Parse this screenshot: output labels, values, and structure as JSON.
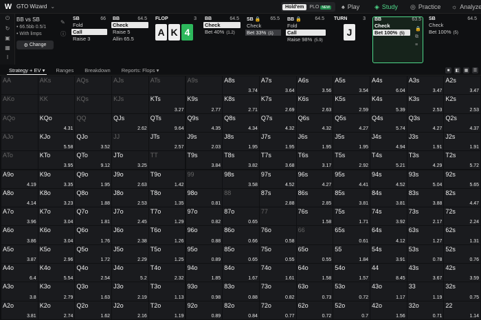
{
  "app": {
    "brand": "GTO Wizard"
  },
  "modes": [
    {
      "label": "Hold'em",
      "active": true
    },
    {
      "label": "PLO",
      "active": false,
      "badge": "NEW"
    }
  ],
  "nav": [
    {
      "label": "Play",
      "icon": "spade-icon",
      "glyph": "♠",
      "active": false
    },
    {
      "label": "Study",
      "icon": "study-icon",
      "glyph": "◈",
      "active": true
    },
    {
      "label": "Practice",
      "icon": "gamepad-icon",
      "glyph": "◎",
      "active": false
    },
    {
      "label": "Analyze",
      "icon": "analyze-icon",
      "glyph": "☼",
      "active": false
    }
  ],
  "spot": {
    "title": "BB vs SB",
    "stack_line": "66.5bb 0.5/1",
    "limp_line": "With limps",
    "change_label": "Change"
  },
  "columns": [
    {
      "pos": "SB",
      "stack": "66",
      "actions": [
        {
          "label": "Fold",
          "style": ""
        },
        {
          "label": "Call",
          "style": "sel"
        },
        {
          "label": "Raise 3",
          "style": ""
        }
      ]
    },
    {
      "pos": "BB",
      "stack": "64.5",
      "actions": [
        {
          "label": "Check",
          "style": "sel"
        },
        {
          "label": "Raise 5",
          "style": ""
        },
        {
          "label": "Allin 65.5",
          "style": ""
        }
      ]
    },
    {
      "pos": "FLOP",
      "stack": "3",
      "cards": [
        {
          "r": "A",
          "g": false
        },
        {
          "r": "K",
          "g": false
        },
        {
          "r": "4",
          "g": true
        }
      ]
    },
    {
      "pos": "BB",
      "stack": "64.5",
      "actions": [
        {
          "label": "Check",
          "style": "sel"
        },
        {
          "label": "Bet 40%",
          "style": "",
          "n": "(1.2)"
        }
      ]
    },
    {
      "pos": "SB",
      "stack": "65.5",
      "lock": true,
      "actions": [
        {
          "label": "Check",
          "style": ""
        },
        {
          "label": "Bet 33%",
          "style": "dk",
          "n": "(1)"
        }
      ]
    },
    {
      "pos": "BB",
      "stack": "64.5",
      "lock": true,
      "actions": [
        {
          "label": "Fold",
          "style": ""
        },
        {
          "label": "Call",
          "style": "sel"
        },
        {
          "label": "Raise 98%",
          "style": "",
          "n": "(5.9)"
        }
      ]
    },
    {
      "pos": "TURN",
      "stack": "3",
      "cards": [
        {
          "r": "J",
          "g": false
        }
      ]
    },
    {
      "pos": "BB",
      "stack": "63.5",
      "current": true,
      "actions": [
        {
          "label": "Check",
          "style": ""
        },
        {
          "label": "Bet 100%",
          "style": "",
          "n": "(5)"
        }
      ]
    },
    {
      "pos": "SB",
      "stack": "64.5",
      "actions": [
        {
          "label": "Check",
          "style": ""
        },
        {
          "label": "Bet 100%",
          "style": "",
          "n": "(5)"
        }
      ]
    }
  ],
  "tabs": [
    {
      "label": "Strategy + EV ▾",
      "active": true
    },
    {
      "label": "Ranges",
      "active": false
    },
    {
      "label": "Breakdown",
      "active": false
    },
    {
      "label": "Reports: Flops ▾",
      "active": false
    }
  ],
  "hands": [
    [
      "AA",
      "",
      "0"
    ],
    [
      "AKs",
      "",
      "0"
    ],
    [
      "AQs",
      "",
      "0"
    ],
    [
      "AJs",
      "",
      "0"
    ],
    [
      "ATs",
      "",
      "0"
    ],
    [
      "A9s",
      "",
      "0"
    ],
    [
      "A8s",
      "3.74",
      "0.06"
    ],
    [
      "A7s",
      "3.64",
      "0.06"
    ],
    [
      "A6s",
      "3.56",
      "0.05"
    ],
    [
      "A5s",
      "3.54",
      "0.05"
    ],
    [
      "A4s",
      "6.04",
      "0.04"
    ],
    [
      "A3s",
      "3.47",
      "0.28"
    ],
    [
      "A2s",
      "3.47",
      "0.5"
    ],
    [
      "AKo",
      "",
      "0"
    ],
    [
      "KK",
      "",
      "0"
    ],
    [
      "KQs",
      "",
      "0"
    ],
    [
      "KJs",
      "",
      "0"
    ],
    [
      "KTs",
      "3.27",
      "0"
    ],
    [
      "K9s",
      "2.77",
      "0.04"
    ],
    [
      "K8s",
      "2.71",
      "0.04"
    ],
    [
      "K7s",
      "2.69",
      "0.1"
    ],
    [
      "K6s",
      "2.63",
      "0.1"
    ],
    [
      "K5s",
      "2.59",
      "0.8"
    ],
    [
      "K4s",
      "5.39",
      "0.7"
    ],
    [
      "K3s",
      "2.53",
      "0.96"
    ],
    [
      "K2s",
      "2.53",
      "0.96"
    ],
    [
      "AQo",
      "",
      "0"
    ],
    [
      "KQo",
      "4.31",
      "0"
    ],
    [
      "QQ",
      "",
      "0"
    ],
    [
      "QJs",
      "2.62",
      "0"
    ],
    [
      "QTs",
      "9.64",
      "0"
    ],
    [
      "Q9s",
      "4.35",
      "0.04"
    ],
    [
      "Q8s",
      "4.34",
      "0.15"
    ],
    [
      "Q7s",
      "4.32",
      "0.9"
    ],
    [
      "Q6s",
      "4.32",
      "0.9"
    ],
    [
      "Q5s",
      "4.27",
      "0.9"
    ],
    [
      "Q4s",
      "5.74",
      "0.9"
    ],
    [
      "Q3s",
      "4.27",
      "0.96"
    ],
    [
      "Q2s",
      "4.37",
      "0.96"
    ],
    [
      "AJo",
      "",
      "0"
    ],
    [
      "KJo",
      "5.58",
      "0"
    ],
    [
      "QJo",
      "3.52",
      "0.15"
    ],
    [
      "JJ",
      "",
      "0"
    ],
    [
      "JTs",
      "2.57",
      "0"
    ],
    [
      "J9s",
      "2.03",
      "0.06"
    ],
    [
      "J8s",
      "1.95",
      "0.96"
    ],
    [
      "J7s",
      "1.95",
      "0.96"
    ],
    [
      "J6s",
      "1.95",
      "0.96"
    ],
    [
      "J5s",
      "1.95",
      "0.96"
    ],
    [
      "J4s",
      "4.94",
      "0.96"
    ],
    [
      "J3s",
      "1.91",
      "0.96"
    ],
    [
      "J2s",
      "1.91",
      "0.96"
    ],
    [
      "ATo",
      "",
      "0"
    ],
    [
      "KTo",
      "3.95",
      "0.25"
    ],
    [
      "QTo",
      "9.12",
      "0.4"
    ],
    [
      "JTo",
      "3.25",
      "0.45"
    ],
    [
      "TT",
      "",
      "0"
    ],
    [
      "T9s",
      "3.84",
      "0.06"
    ],
    [
      "T8s",
      "3.82",
      "0.96"
    ],
    [
      "T7s",
      "3.68",
      "0.96"
    ],
    [
      "T6s",
      "3.17",
      "0.96"
    ],
    [
      "T5s",
      "2.92",
      "0.96"
    ],
    [
      "T4s",
      "5.21",
      "0.96"
    ],
    [
      "T3s",
      "4.29",
      "0.96"
    ],
    [
      "T2s",
      "5.72",
      "0.96"
    ],
    [
      "A9o",
      "4.19",
      "0"
    ],
    [
      "K9o",
      "3.35",
      "0.45"
    ],
    [
      "Q9o",
      "1.95",
      "0.96"
    ],
    [
      "J9o",
      "2.63",
      "0.96"
    ],
    [
      "T9o",
      "1.42",
      "0.96"
    ],
    [
      "99",
      "",
      "0"
    ],
    [
      "98s",
      "3.58",
      "0.06"
    ],
    [
      "97s",
      "4.52",
      "0.96"
    ],
    [
      "96s",
      "4.27",
      "0.96"
    ],
    [
      "95s",
      "4.41",
      "0.96"
    ],
    [
      "94s",
      "4.52",
      "0.96"
    ],
    [
      "93s",
      "5.04",
      "0.96"
    ],
    [
      "92s",
      "5.65",
      "0.96"
    ],
    [
      "A8o",
      "4.14",
      "0"
    ],
    [
      "K8o",
      "3.23",
      "0.45"
    ],
    [
      "Q8o",
      "1.88",
      "0.96"
    ],
    [
      "J8o",
      "2.53",
      "0.96"
    ],
    [
      "T8o",
      "1.35",
      "0.96"
    ],
    [
      "98o",
      "0.81",
      "0.96"
    ],
    [
      "88",
      "",
      "0"
    ],
    [
      "87s",
      "2.88",
      "0.96"
    ],
    [
      "86s",
      "2.85",
      "0.96"
    ],
    [
      "85s",
      "3.81",
      "0.96"
    ],
    [
      "84s",
      "3.81",
      "0.96"
    ],
    [
      "83s",
      "3.88",
      "0.96"
    ],
    [
      "82s",
      "4.47",
      "0.96"
    ],
    [
      "A7o",
      "3.96",
      "0"
    ],
    [
      "K7o",
      "3.04",
      "0.45"
    ],
    [
      "Q7o",
      "1.81",
      "0.96"
    ],
    [
      "J7o",
      "2.45",
      "0.96"
    ],
    [
      "T7o",
      "1.29",
      "0.96"
    ],
    [
      "97o",
      "0.82",
      "0.96"
    ],
    [
      "87o",
      "0.65",
      "0.96"
    ],
    [
      "77",
      "",
      "0"
    ],
    [
      "76s",
      "1.58",
      "0.04"
    ],
    [
      "75s",
      "1.71",
      "0.04"
    ],
    [
      "74s",
      "3.92",
      "0.1"
    ],
    [
      "73s",
      "2.17",
      "0.96"
    ],
    [
      "72s",
      "2.24",
      "0.96"
    ],
    [
      "A6o",
      "3.86",
      "0.96"
    ],
    [
      "K6o",
      "3.04",
      "0.96"
    ],
    [
      "Q6o",
      "1.76",
      "0.96"
    ],
    [
      "J6o",
      "2.38",
      "0.96"
    ],
    [
      "T6o",
      "1.26",
      "0.96"
    ],
    [
      "96o",
      "0.88",
      "0.96"
    ],
    [
      "86o",
      "0.66",
      "0.96"
    ],
    [
      "76o",
      "0.58",
      "0.96"
    ],
    [
      "66",
      "",
      "0"
    ],
    [
      "65s",
      "0.61",
      "0.04"
    ],
    [
      "64s",
      "4.12",
      "0.04"
    ],
    [
      "63s",
      "1.27",
      "0.04"
    ],
    [
      "62s",
      "1.31",
      "0.04"
    ],
    [
      "A5o",
      "3.87",
      "0.96"
    ],
    [
      "K5o",
      "2.96",
      "0.96"
    ],
    [
      "Q5o",
      "1.72",
      "0.96"
    ],
    [
      "J5o",
      "2.29",
      "0.96"
    ],
    [
      "T5o",
      "1.25",
      "0.96"
    ],
    [
      "95o",
      "0.89",
      "0.96"
    ],
    [
      "85o",
      "0.65",
      "0.96"
    ],
    [
      "75o",
      "0.55",
      "0.96"
    ],
    [
      "65o",
      "0.55",
      "0.96"
    ],
    [
      "55",
      "1.84",
      "0"
    ],
    [
      "54s",
      "3.91",
      "0.04"
    ],
    [
      "53s",
      "0.78",
      "0.04"
    ],
    [
      "52s",
      "0.76",
      "0.04"
    ],
    [
      "A4o",
      "6.4",
      "0.96"
    ],
    [
      "K4o",
      "5.54",
      "0.96"
    ],
    [
      "Q4o",
      "2.54",
      "0.96"
    ],
    [
      "J4o",
      "5.2",
      "0.96"
    ],
    [
      "T4o",
      "2.32",
      "0.96"
    ],
    [
      "94o",
      "1.85",
      "0.96"
    ],
    [
      "84o",
      "1.67",
      "0.96"
    ],
    [
      "74o",
      "1.61",
      "0.96"
    ],
    [
      "64o",
      "1.58",
      "0.96"
    ],
    [
      "54o",
      "1.57",
      "0.96"
    ],
    [
      "44",
      "8.45",
      "0"
    ],
    [
      "43s",
      "3.67",
      "0.04"
    ],
    [
      "42s",
      "3.59",
      "0.04"
    ],
    [
      "A3o",
      "3.8",
      "0.96"
    ],
    [
      "K3o",
      "2.79",
      "0.96"
    ],
    [
      "Q3o",
      "1.63",
      "0.96"
    ],
    [
      "J3o",
      "2.19",
      "0.96"
    ],
    [
      "T3o",
      "1.13",
      "0.96"
    ],
    [
      "93o",
      "0.98",
      "0.96"
    ],
    [
      "83o",
      "0.88",
      "0.96"
    ],
    [
      "73o",
      "0.82",
      "0.96"
    ],
    [
      "63o",
      "0.73",
      "0.96"
    ],
    [
      "53o",
      "0.72",
      "0.96"
    ],
    [
      "43o",
      "1.17",
      "0.96"
    ],
    [
      "33",
      "1.19",
      "0.04"
    ],
    [
      "32s",
      "0.75",
      "0.04"
    ],
    [
      "A2o",
      "3.81",
      "0.96"
    ],
    [
      "K2o",
      "2.74",
      "0.96"
    ],
    [
      "Q2o",
      "1.62",
      "0.96"
    ],
    [
      "J2o",
      "2.16",
      "0.96"
    ],
    [
      "T2o",
      "1.19",
      "0.96"
    ],
    [
      "92o",
      "0.89",
      "0.96"
    ],
    [
      "82o",
      "0.84",
      "0.96"
    ],
    [
      "72o",
      "0.77",
      "0.96"
    ],
    [
      "62o",
      "0.72",
      "0.96"
    ],
    [
      "52o",
      "0.7",
      "0.96"
    ],
    [
      "42o",
      "1.56",
      "0.96"
    ],
    [
      "32o",
      "0.71",
      "0.96"
    ],
    [
      "22",
      "1.14",
      "0.96"
    ]
  ]
}
